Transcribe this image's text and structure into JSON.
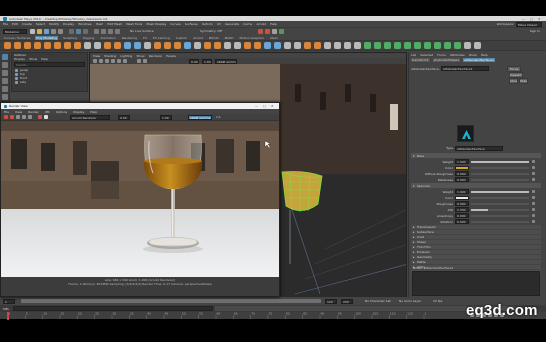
{
  "app": {
    "title": "Autodesk Maya 2019: ...Desktop/Whiskey/Whiskey_Glassware.mb",
    "menus": [
      "File",
      "Edit",
      "Create",
      "Select",
      "Modify",
      "Display",
      "Windows",
      "Mesh",
      "Edit Mesh",
      "Mesh Tools",
      "Mesh Display",
      "Curves",
      "Surfaces",
      "Deform",
      "UV",
      "Generate",
      "Cache",
      "Arnold",
      "Help"
    ],
    "workspace_label": "Workspace:",
    "workspace_value": "Maya Classic",
    "menu_set": "Modeling",
    "live_surface": "No Live Surface",
    "symmetry": "Symmetry: Off",
    "sign_in": "Sign In"
  },
  "shelf": {
    "tabs": [
      "Curves / Surfaces",
      "Poly Modeling",
      "Sculpting",
      "Rigging",
      "Animation",
      "Rendering",
      "FX",
      "FX Caching",
      "Custom",
      "Arnold",
      "Bifrost",
      "MASH",
      "Motion Graphics",
      "XGen"
    ],
    "active_tab": "Poly Modeling"
  },
  "outliner": {
    "title": "Outliner",
    "menus": [
      "Display",
      "Show",
      "Help"
    ],
    "search_placeholder": "Search...",
    "items": [
      "persp",
      "top",
      "front",
      "side"
    ]
  },
  "viewport": {
    "menus": [
      "View",
      "Shading",
      "Lighting",
      "Show",
      "Renderer",
      "Panels"
    ],
    "colorspace": "sRGB gamma",
    "value_a": "0.00",
    "value_b": "1.00"
  },
  "render_view": {
    "title": "Render View",
    "menus": [
      "File",
      "View",
      "Render",
      "IPR",
      "Options",
      "Display",
      "Help"
    ],
    "camera": "Arnold Renderer",
    "exposure": "0.00",
    "gamma": "1.00",
    "colorspace": "sRGB gamma",
    "ratio": "1:1",
    "status": "size: 960 x 540 zoom: 1.000    (Arnold Renderer)",
    "status2": "Frame: 1    Memory: 3024Mb    Sampling: [3/2/2/2/2]    Render Time: 0:17    Camera: perspectiveShape"
  },
  "attribute_editor": {
    "tabs": [
      "List",
      "Selected",
      "Focus",
      "Attributes",
      "Show",
      "Help"
    ],
    "node_tabs": [
      "transform1",
      "pCylinderShape1",
      "aiStandardSurface1"
    ],
    "node_label": "aiStandardSurface:",
    "node_name": "aiStandardSurface1",
    "focus_btn": "Focus",
    "presets_btn": "Presets*",
    "show_btn": "Show",
    "hide_btn": "Hide",
    "type_label": "Type",
    "type_value": "aiStandardSurface",
    "sections": [
      {
        "name": "Base",
        "rows": [
          {
            "label": "Weight",
            "value": "1.000",
            "fill": 1.0
          },
          {
            "label": "Color",
            "value": "",
            "fill": 0.0,
            "swatch": "#d6a826"
          },
          {
            "label": "Diffuse Roughness",
            "value": "0.000",
            "fill": 0.0
          },
          {
            "label": "Metalness",
            "value": "0.000",
            "fill": 0.0
          }
        ]
      },
      {
        "name": "Specular",
        "rows": [
          {
            "label": "Weight",
            "value": "1.000",
            "fill": 1.0
          },
          {
            "label": "Color",
            "value": "",
            "fill": 0.0,
            "swatch": "#e8e8e8"
          },
          {
            "label": "Roughness",
            "value": "0.000",
            "fill": 0.0
          },
          {
            "label": "IOR",
            "value": "1.330",
            "fill": 0.3
          },
          {
            "label": "Anisotropy",
            "value": "0.000",
            "fill": 0.0
          },
          {
            "label": "Rotation",
            "value": "0.000",
            "fill": 0.0
          }
        ]
      }
    ],
    "collapsed": [
      "Transmission",
      "Subsurface",
      "Coat",
      "Sheen",
      "Thin Film",
      "Emission",
      "Geometry",
      "Matte",
      "AOVs",
      "Hardware Texturing"
    ],
    "notes_label": "Notes: aiStandardSurface1",
    "bottom_buttons": [
      "Select",
      "Load Attributes",
      "Copy Tab"
    ]
  },
  "timeline": {
    "ticks": [
      "1",
      "5",
      "10",
      "15",
      "20",
      "25",
      "30",
      "35",
      "40",
      "45",
      "50",
      "55",
      "60",
      "65",
      "70",
      "75",
      "80",
      "85",
      "90",
      "95",
      "100",
      "105",
      "110",
      "115",
      "120"
    ],
    "current": "1",
    "start": "1",
    "end": "120",
    "range_start": "1",
    "range_end": "200",
    "char_set": "No Character Set",
    "anim_layer": "No Anim Layer",
    "fps": "24 fps"
  },
  "command_line": {
    "label": "MEL"
  },
  "watermark": "eq3d.com",
  "colors": {
    "maya_bg": "#444444",
    "panel": "#3c3c3c",
    "highlight": "#5285a6",
    "whiskey": "#c8901f",
    "wireframe": "#7ee03c"
  }
}
